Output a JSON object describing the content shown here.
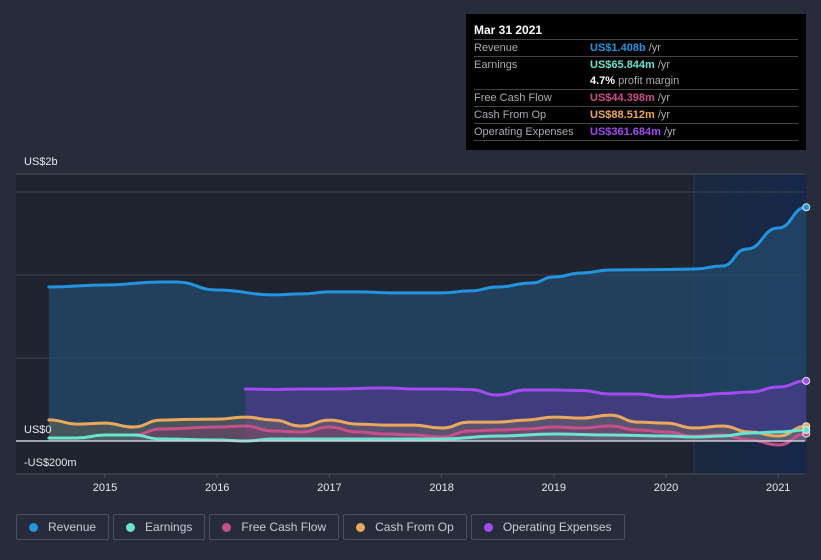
{
  "tooltip": {
    "date": "Mar 31 2021",
    "rows": [
      {
        "label": "Revenue",
        "value": "US$1.408b",
        "unit": "/yr",
        "color": "#2394df"
      },
      {
        "label": "Earnings",
        "value": "US$65.844m",
        "unit": "/yr",
        "color": "#6ce3cf"
      },
      {
        "label": "",
        "margin_value": "4.7%",
        "margin_text": "profit margin"
      },
      {
        "label": "Free Cash Flow",
        "value": "US$44.398m",
        "unit": "/yr",
        "color": "#c8508a"
      },
      {
        "label": "Cash From Op",
        "value": "US$88.512m",
        "unit": "/yr",
        "color": "#e9a85d"
      },
      {
        "label": "Operating Expenses",
        "value": "US$361.684m",
        "unit": "/yr",
        "color": "#a24bf0"
      }
    ]
  },
  "legend": [
    {
      "label": "Revenue",
      "color": "#2394df"
    },
    {
      "label": "Earnings",
      "color": "#6ce3cf"
    },
    {
      "label": "Free Cash Flow",
      "color": "#c8508a"
    },
    {
      "label": "Cash From Op",
      "color": "#e9a85d"
    },
    {
      "label": "Operating Expenses",
      "color": "#a24bf0"
    }
  ],
  "chart_data": {
    "type": "area",
    "title": "",
    "xlabel": "",
    "ylabel": "",
    "y_top_label": "US$2b",
    "y_zero_label": "US$0",
    "y_bottom_label": "-US$200m",
    "ylim_millions": [
      -200,
      1610
    ],
    "xlim_years": [
      2013.9,
      2021.25
    ],
    "x_ticks": [
      "2015",
      "2016",
      "2017",
      "2018",
      "2019",
      "2020",
      "2021"
    ],
    "x_tick_values": [
      2015,
      2016,
      2017,
      2018,
      2019,
      2020,
      2021
    ],
    "grid_millions": [
      500,
      1000,
      1500
    ],
    "highlight_range_years": [
      2020.25,
      2021.25
    ],
    "legend_position": "bottom",
    "series": [
      {
        "name": "Revenue",
        "color": "#2394df",
        "x": [
          2014.5,
          2015.0,
          2015.5,
          2015.63,
          2016.0,
          2016.5,
          2016.75,
          2017.0,
          2017.25,
          2017.6,
          2018.0,
          2018.25,
          2018.5,
          2018.8,
          2019.0,
          2019.25,
          2019.5,
          2020.0,
          2020.25,
          2020.5,
          2020.72,
          2021.0,
          2021.25
        ],
        "values": [
          928,
          940,
          958,
          958,
          910,
          880,
          886,
          898,
          898,
          892,
          892,
          904,
          928,
          952,
          988,
          1012,
          1030,
          1033,
          1036,
          1054,
          1157,
          1283,
          1408
        ]
      },
      {
        "name": "Operating Expenses",
        "color": "#a24bf0",
        "x": [
          2016.25,
          2016.5,
          2016.75,
          2017.0,
          2017.5,
          2017.75,
          2018.0,
          2018.25,
          2018.5,
          2018.75,
          2019.0,
          2019.25,
          2019.5,
          2019.75,
          2020.0,
          2020.25,
          2020.5,
          2020.75,
          2021.0,
          2021.25
        ],
        "values": [
          313,
          310,
          313,
          313,
          319,
          313,
          313,
          310,
          277,
          307,
          307,
          304,
          283,
          283,
          265,
          273,
          286,
          295,
          325,
          362
        ]
      },
      {
        "name": "Cash From Op",
        "color": "#e9a85d",
        "x": [
          2014.5,
          2014.75,
          2015.0,
          2015.25,
          2015.5,
          2015.75,
          2016.0,
          2016.25,
          2016.5,
          2016.75,
          2017.0,
          2017.25,
          2017.5,
          2017.75,
          2018.0,
          2018.25,
          2018.5,
          2018.75,
          2019.0,
          2019.25,
          2019.5,
          2019.75,
          2020.0,
          2020.25,
          2020.5,
          2020.75,
          2021.0,
          2021.25
        ],
        "values": [
          127,
          102,
          108,
          84,
          126,
          130,
          132,
          144,
          126,
          90,
          126,
          102,
          96,
          96,
          78,
          114,
          114,
          126,
          144,
          138,
          156,
          114,
          108,
          78,
          90,
          54,
          30,
          89
        ]
      },
      {
        "name": "Free Cash Flow",
        "color": "#c8508a",
        "x": [
          2015.25,
          2015.5,
          2016.0,
          2016.25,
          2016.5,
          2016.75,
          2017.0,
          2017.25,
          2017.5,
          2017.75,
          2018.0,
          2018.25,
          2018.5,
          2018.75,
          2019.0,
          2019.25,
          2019.5,
          2019.75,
          2020.0,
          2020.25,
          2020.5,
          2020.75,
          2021.0,
          2021.25
        ],
        "values": [
          36,
          72,
          84,
          90,
          60,
          54,
          84,
          54,
          42,
          36,
          24,
          60,
          66,
          72,
          84,
          78,
          90,
          66,
          54,
          30,
          36,
          6,
          -24,
          44
        ]
      },
      {
        "name": "Earnings",
        "color": "#6ce3cf",
        "x": [
          2014.5,
          2014.75,
          2015.0,
          2015.25,
          2015.5,
          2016.0,
          2016.25,
          2016.5,
          2017.0,
          2017.5,
          2018.0,
          2018.5,
          2019.0,
          2019.5,
          2020.0,
          2020.25,
          2020.5,
          2020.75,
          2021.0,
          2021.25
        ],
        "values": [
          18,
          18,
          36,
          36,
          12,
          6,
          0,
          12,
          12,
          12,
          12,
          30,
          42,
          36,
          30,
          24,
          30,
          48,
          54,
          66
        ]
      }
    ]
  }
}
